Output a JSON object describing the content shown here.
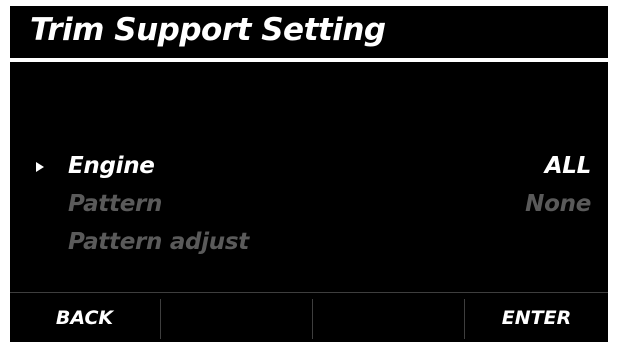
{
  "screen": {
    "title": "Trim Support Setting"
  },
  "menu": {
    "items": [
      {
        "label": "Engine",
        "value": "ALL",
        "selected": true,
        "enabled": true
      },
      {
        "label": "Pattern",
        "value": "None",
        "selected": false,
        "enabled": false
      },
      {
        "label": "Pattern adjust",
        "value": "",
        "selected": false,
        "enabled": false
      }
    ]
  },
  "softkeys": {
    "key1": "BACK",
    "key2": "",
    "key3": "",
    "key4": "ENTER"
  },
  "colors": {
    "background": "#000000",
    "text_active": "#ffffff",
    "text_disabled": "#5a5a5a",
    "divider": "#3e3e3e"
  },
  "icons": {
    "selection_cursor": "triangle-right-icon"
  }
}
